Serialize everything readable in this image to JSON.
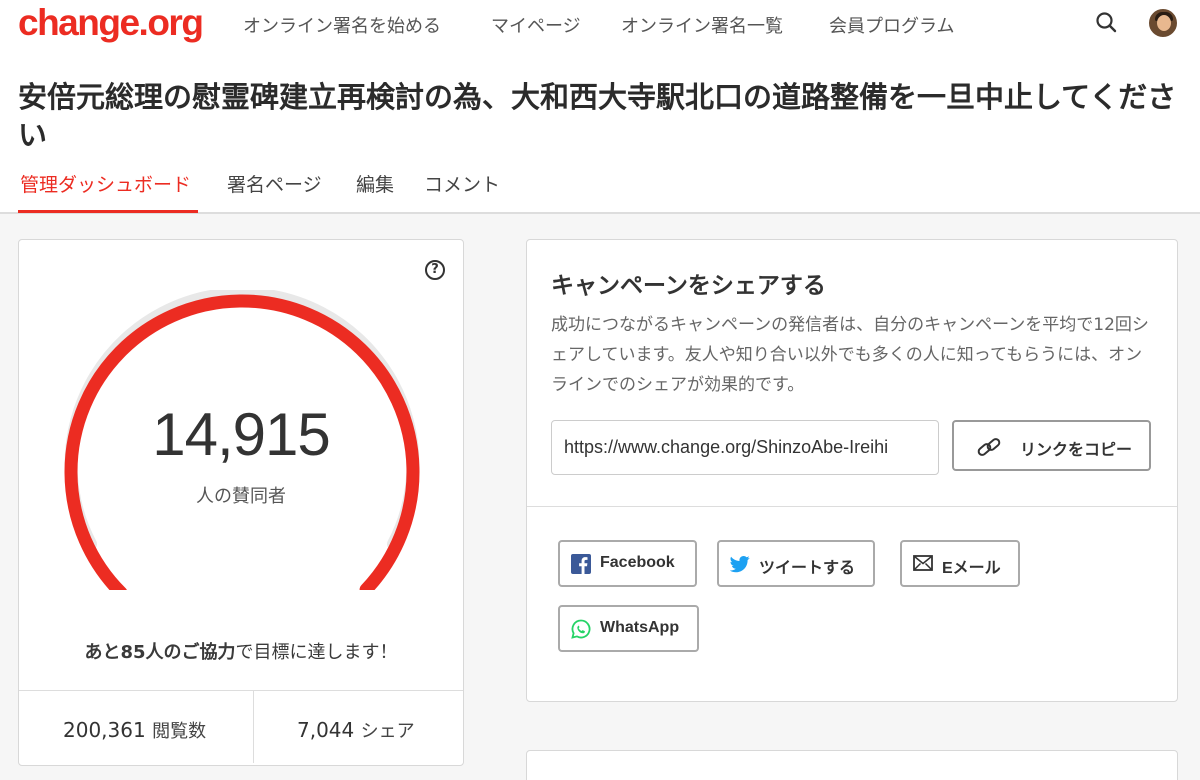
{
  "brand": {
    "logo_text": "change.org",
    "accent": "#ec2c22"
  },
  "nav": {
    "items": [
      "オンライン署名を始める",
      "マイページ",
      "オンライン署名一覧",
      "会員プログラム"
    ],
    "search_icon": "search-icon",
    "avatar": "user-avatar"
  },
  "petition": {
    "title": "安倍元総理の慰霊碑建立再検討の為、大和西大寺駅北口の道路整備を一旦中止してください"
  },
  "tabs": [
    {
      "label": "管理ダッシュボード",
      "active": true
    },
    {
      "label": "署名ページ",
      "active": false
    },
    {
      "label": "編集",
      "active": false
    },
    {
      "label": "コメント",
      "active": false
    }
  ],
  "progress": {
    "count": "14,915",
    "count_label": "人の賛同者",
    "goal_progress_fraction": 0.9943,
    "goal_bold": "あと85人のご協力",
    "goal_rest": "で目標に達します！",
    "help_icon": "?",
    "views_value": "200,361",
    "views_label": "閲覧数",
    "shares_value": "7,044",
    "shares_label": "シェア"
  },
  "share": {
    "title": "キャンペーンをシェアする",
    "description": "成功につながるキャンペーンの発信者は、自分のキャンペーンを平均で12回シェアしています。友人や知り合い以外でも多くの人に知ってもらうには、オンラインでのシェアが効果的です。",
    "url": "https://www.change.org/ShinzoAbe-Ireihi",
    "copy_label": "リンクをコピー",
    "buttons": {
      "facebook": "Facebook",
      "tweet": "ツイートする",
      "email": "Eメール",
      "whatsapp": "WhatsApp"
    },
    "colors": {
      "facebook": "#3b5998",
      "twitter": "#1da1f2",
      "whatsapp": "#25d366"
    }
  }
}
